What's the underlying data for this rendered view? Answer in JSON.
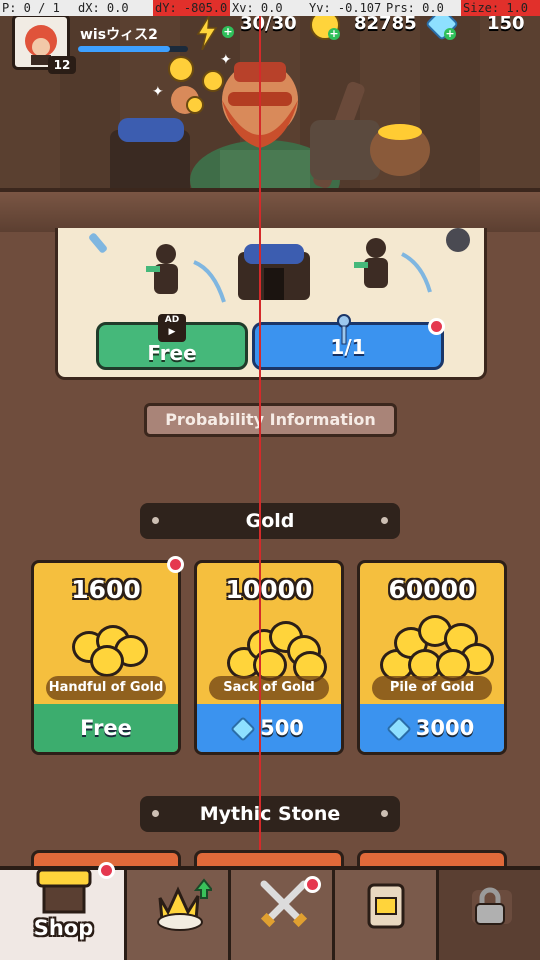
{
  "debug_bar": {
    "pointer": "P: 0 / 1",
    "dx": "dX: 0.0",
    "dy": "dY: -805.0",
    "xv": "Xv: 0.0",
    "yv": "Yv: -0.107",
    "prs": "Prs: 0.0",
    "size": "Size: 1.0"
  },
  "player": {
    "name": "wisウィス2",
    "level": "12",
    "xp_fraction": 0.84
  },
  "resources": {
    "stamina": "30/30",
    "gold": "82785",
    "gems": "150"
  },
  "chest": {
    "free_button": "Free",
    "ad_badge": "AD",
    "key_button": "1/1"
  },
  "probability_button": "Probability Information",
  "sections": {
    "gold": "Gold",
    "mythic_stone": "Mythic Stone"
  },
  "gold_offers": [
    {
      "amount": "1600",
      "name": "Handful of Gold",
      "price": "Free",
      "price_type": "free"
    },
    {
      "amount": "10000",
      "name": "Sack of Gold",
      "price": "500",
      "price_type": "gem"
    },
    {
      "amount": "60000",
      "name": "Pile of Gold",
      "price": "3000",
      "price_type": "gem"
    }
  ],
  "nav": {
    "shop_label": "Shop"
  },
  "colors": {
    "accent_blue": "#3b93ef",
    "accent_green": "#45b87a",
    "gold": "#f5bf3e",
    "notification": "#e5384f"
  }
}
